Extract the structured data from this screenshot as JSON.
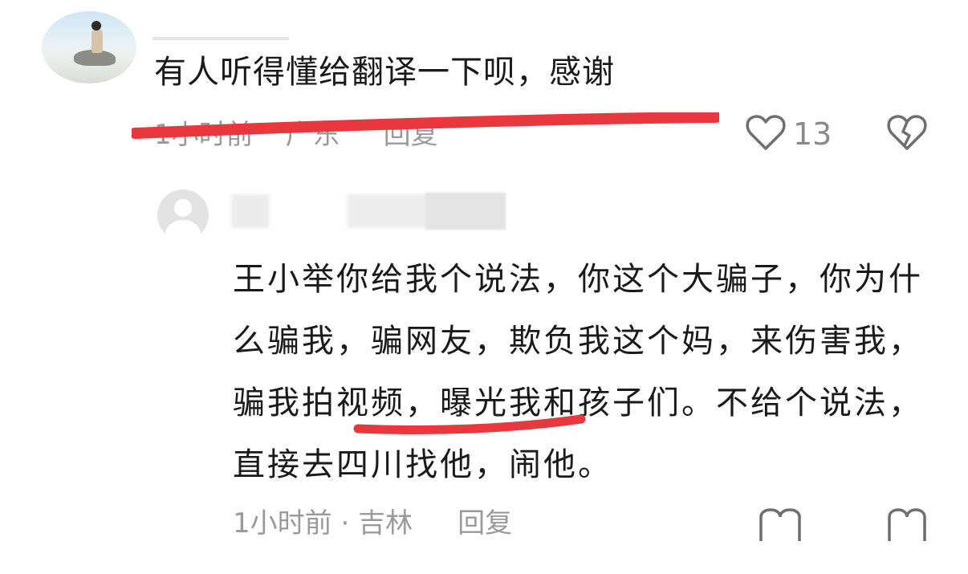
{
  "top_comment": {
    "text": "有人听得懂给翻译一下呗，感谢",
    "time": "1小时前",
    "location": "广东",
    "reply_label": "回复",
    "like_count": "13"
  },
  "reply_comment": {
    "text": "王小举你给我个说法，你这个大骗子，你为什么骗我，骗网友，欺负我这个妈，来伤害我，骗我拍视频，曝光我和孩子们。不给个说法，直接去四川找他，闹他。",
    "time": "1小时前",
    "separator": "·",
    "location": "吉林",
    "reply_label": "回复"
  },
  "colors": {
    "annotation_red": "#e8373d",
    "meta_gray": "#9a9a9a"
  }
}
